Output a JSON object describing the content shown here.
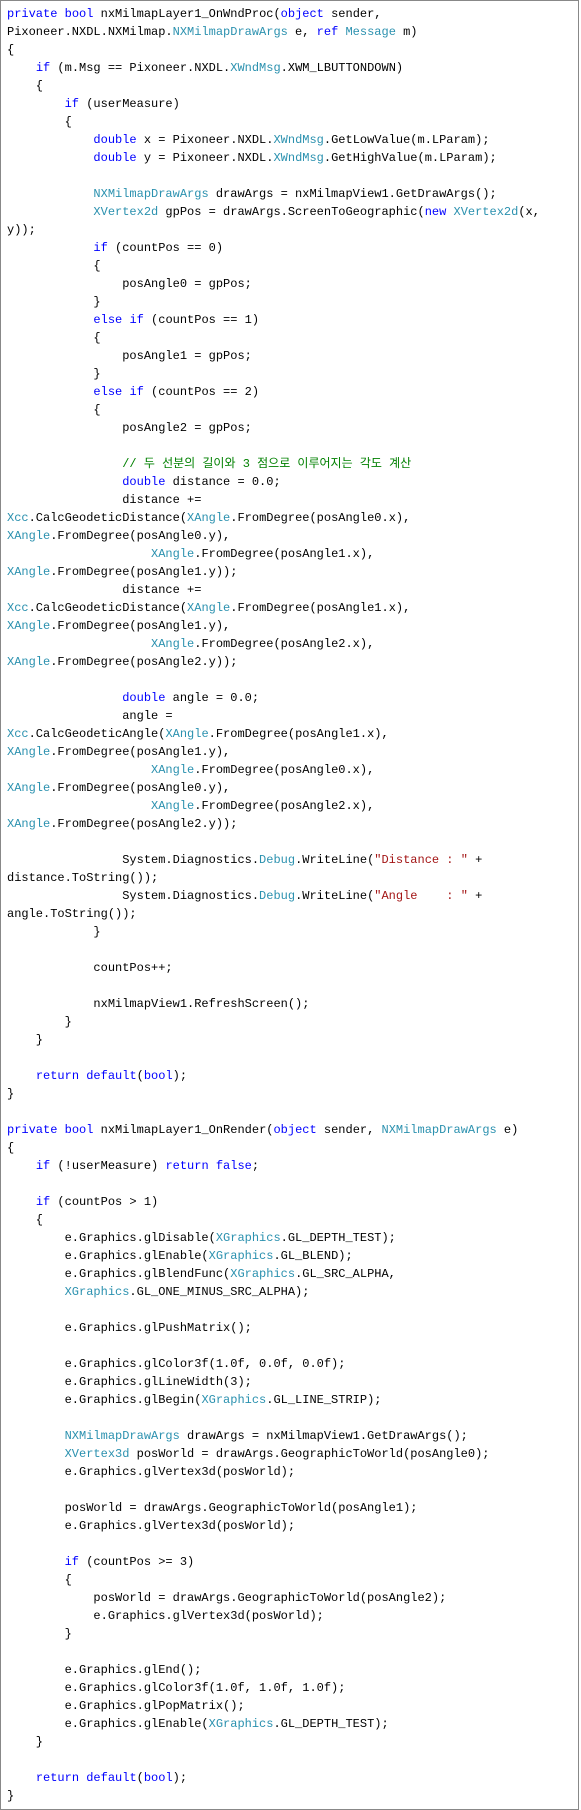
{
  "code": {
    "lines": [
      [
        [
          "k",
          "private"
        ],
        [
          "p",
          " "
        ],
        [
          "k",
          "bool"
        ],
        [
          "p",
          " nxMilmapLayer1_OnWndProc("
        ],
        [
          "k",
          "object"
        ],
        [
          "p",
          " sender, "
        ]
      ],
      [
        [
          "p",
          "Pixoneer.NXDL.NXMilmap."
        ],
        [
          "t",
          "NXMilmapDrawArgs"
        ],
        [
          "p",
          " e, "
        ],
        [
          "k",
          "ref"
        ],
        [
          "p",
          " "
        ],
        [
          "t",
          "Message"
        ],
        [
          "p",
          " m)"
        ]
      ],
      [
        [
          "p",
          "{"
        ]
      ],
      [
        [
          "p",
          "    "
        ],
        [
          "k",
          "if"
        ],
        [
          "p",
          " (m.Msg == Pixoneer.NXDL."
        ],
        [
          "t",
          "XWndMsg"
        ],
        [
          "p",
          ".XWM_LBUTTONDOWN)"
        ]
      ],
      [
        [
          "p",
          "    {"
        ]
      ],
      [
        [
          "p",
          "        "
        ],
        [
          "k",
          "if"
        ],
        [
          "p",
          " (userMeasure)"
        ]
      ],
      [
        [
          "p",
          "        {"
        ]
      ],
      [
        [
          "p",
          "            "
        ],
        [
          "k",
          "double"
        ],
        [
          "p",
          " x = Pixoneer.NXDL."
        ],
        [
          "t",
          "XWndMsg"
        ],
        [
          "p",
          ".GetLowValue(m.LParam);"
        ]
      ],
      [
        [
          "p",
          "            "
        ],
        [
          "k",
          "double"
        ],
        [
          "p",
          " y = Pixoneer.NXDL."
        ],
        [
          "t",
          "XWndMsg"
        ],
        [
          "p",
          ".GetHighValue(m.LParam);"
        ]
      ],
      [
        [
          "p",
          " "
        ]
      ],
      [
        [
          "p",
          "            "
        ],
        [
          "t",
          "NXMilmapDrawArgs"
        ],
        [
          "p",
          " drawArgs = nxMilmapView1.GetDrawArgs();"
        ]
      ],
      [
        [
          "p",
          "            "
        ],
        [
          "t",
          "XVertex2d"
        ],
        [
          "p",
          " gpPos = drawArgs.ScreenToGeographic("
        ],
        [
          "k",
          "new"
        ],
        [
          "p",
          " "
        ],
        [
          "t",
          "XVertex2d"
        ],
        [
          "p",
          "(x, "
        ]
      ],
      [
        [
          "p",
          "y));"
        ]
      ],
      [
        [
          "p",
          "            "
        ],
        [
          "k",
          "if"
        ],
        [
          "p",
          " (countPos == 0)"
        ]
      ],
      [
        [
          "p",
          "            {"
        ]
      ],
      [
        [
          "p",
          "                posAngle0 = gpPos;"
        ]
      ],
      [
        [
          "p",
          "            }"
        ]
      ],
      [
        [
          "p",
          "            "
        ],
        [
          "k",
          "else"
        ],
        [
          "p",
          " "
        ],
        [
          "k",
          "if"
        ],
        [
          "p",
          " (countPos == 1)"
        ]
      ],
      [
        [
          "p",
          "            {"
        ]
      ],
      [
        [
          "p",
          "                posAngle1 = gpPos;"
        ]
      ],
      [
        [
          "p",
          "            }"
        ]
      ],
      [
        [
          "p",
          "            "
        ],
        [
          "k",
          "else"
        ],
        [
          "p",
          " "
        ],
        [
          "k",
          "if"
        ],
        [
          "p",
          " (countPos == 2)"
        ]
      ],
      [
        [
          "p",
          "            {"
        ]
      ],
      [
        [
          "p",
          "                posAngle2 = gpPos;"
        ]
      ],
      [
        [
          "p",
          " "
        ]
      ],
      [
        [
          "p",
          "                "
        ],
        [
          "c",
          "// 두 선분의 길이와 3 점으로 이루어지는 각도 계산"
        ]
      ],
      [
        [
          "p",
          "                "
        ],
        [
          "k",
          "double"
        ],
        [
          "p",
          " distance = 0.0;"
        ]
      ],
      [
        [
          "p",
          "                distance += "
        ]
      ],
      [
        [
          "t",
          "Xcc"
        ],
        [
          "p",
          ".CalcGeodeticDistance("
        ],
        [
          "t",
          "XAngle"
        ],
        [
          "p",
          ".FromDegree(posAngle0.x), "
        ]
      ],
      [
        [
          "t",
          "XAngle"
        ],
        [
          "p",
          ".FromDegree(posAngle0.y),"
        ]
      ],
      [
        [
          "p",
          "                    "
        ],
        [
          "t",
          "XAngle"
        ],
        [
          "p",
          ".FromDegree(posAngle1.x), "
        ]
      ],
      [
        [
          "t",
          "XAngle"
        ],
        [
          "p",
          ".FromDegree(posAngle1.y));"
        ]
      ],
      [
        [
          "p",
          "                distance += "
        ]
      ],
      [
        [
          "t",
          "Xcc"
        ],
        [
          "p",
          ".CalcGeodeticDistance("
        ],
        [
          "t",
          "XAngle"
        ],
        [
          "p",
          ".FromDegree(posAngle1.x), "
        ]
      ],
      [
        [
          "t",
          "XAngle"
        ],
        [
          "p",
          ".FromDegree(posAngle1.y),"
        ]
      ],
      [
        [
          "p",
          "                    "
        ],
        [
          "t",
          "XAngle"
        ],
        [
          "p",
          ".FromDegree(posAngle2.x), "
        ]
      ],
      [
        [
          "t",
          "XAngle"
        ],
        [
          "p",
          ".FromDegree(posAngle2.y));"
        ]
      ],
      [
        [
          "p",
          " "
        ]
      ],
      [
        [
          "p",
          "                "
        ],
        [
          "k",
          "double"
        ],
        [
          "p",
          " angle = 0.0;"
        ]
      ],
      [
        [
          "p",
          "                angle = "
        ]
      ],
      [
        [
          "t",
          "Xcc"
        ],
        [
          "p",
          ".CalcGeodeticAngle("
        ],
        [
          "t",
          "XAngle"
        ],
        [
          "p",
          ".FromDegree(posAngle1.x), "
        ]
      ],
      [
        [
          "t",
          "XAngle"
        ],
        [
          "p",
          ".FromDegree(posAngle1.y),"
        ]
      ],
      [
        [
          "p",
          "                    "
        ],
        [
          "t",
          "XAngle"
        ],
        [
          "p",
          ".FromDegree(posAngle0.x), "
        ]
      ],
      [
        [
          "t",
          "XAngle"
        ],
        [
          "p",
          ".FromDegree(posAngle0.y),"
        ]
      ],
      [
        [
          "p",
          "                    "
        ],
        [
          "t",
          "XAngle"
        ],
        [
          "p",
          ".FromDegree(posAngle2.x), "
        ]
      ],
      [
        [
          "t",
          "XAngle"
        ],
        [
          "p",
          ".FromDegree(posAngle2.y));"
        ]
      ],
      [
        [
          "p",
          " "
        ]
      ],
      [
        [
          "p",
          "                System.Diagnostics."
        ],
        [
          "t",
          "Debug"
        ],
        [
          "p",
          ".WriteLine("
        ],
        [
          "s",
          "\"Distance : \""
        ],
        [
          "p",
          " + "
        ]
      ],
      [
        [
          "p",
          "distance.ToString());"
        ]
      ],
      [
        [
          "p",
          "                System.Diagnostics."
        ],
        [
          "t",
          "Debug"
        ],
        [
          "p",
          ".WriteLine("
        ],
        [
          "s",
          "\"Angle    : \""
        ],
        [
          "p",
          " + "
        ]
      ],
      [
        [
          "p",
          "angle.ToString());"
        ]
      ],
      [
        [
          "p",
          "            }"
        ]
      ],
      [
        [
          "p",
          " "
        ]
      ],
      [
        [
          "p",
          "            countPos++;"
        ]
      ],
      [
        [
          "p",
          " "
        ]
      ],
      [
        [
          "p",
          "            nxMilmapView1.RefreshScreen();"
        ]
      ],
      [
        [
          "p",
          "        }"
        ]
      ],
      [
        [
          "p",
          "    }"
        ]
      ],
      [
        [
          "p",
          " "
        ]
      ],
      [
        [
          "p",
          "    "
        ],
        [
          "k",
          "return"
        ],
        [
          "p",
          " "
        ],
        [
          "k",
          "default"
        ],
        [
          "p",
          "("
        ],
        [
          "k",
          "bool"
        ],
        [
          "p",
          ");"
        ]
      ],
      [
        [
          "p",
          "}"
        ]
      ],
      [
        [
          "p",
          " "
        ]
      ],
      [
        [
          "k",
          "private"
        ],
        [
          "p",
          " "
        ],
        [
          "k",
          "bool"
        ],
        [
          "p",
          " nxMilmapLayer1_OnRender("
        ],
        [
          "k",
          "object"
        ],
        [
          "p",
          " sender, "
        ],
        [
          "t",
          "NXMilmapDrawArgs"
        ],
        [
          "p",
          " e)"
        ]
      ],
      [
        [
          "p",
          "{"
        ]
      ],
      [
        [
          "p",
          "    "
        ],
        [
          "k",
          "if"
        ],
        [
          "p",
          " (!userMeasure) "
        ],
        [
          "k",
          "return"
        ],
        [
          "p",
          " "
        ],
        [
          "k",
          "false"
        ],
        [
          "p",
          ";"
        ]
      ],
      [
        [
          "p",
          " "
        ]
      ],
      [
        [
          "p",
          "    "
        ],
        [
          "k",
          "if"
        ],
        [
          "p",
          " (countPos > 1)"
        ]
      ],
      [
        [
          "p",
          "    {"
        ]
      ],
      [
        [
          "p",
          "        e.Graphics.glDisable("
        ],
        [
          "t",
          "XGraphics"
        ],
        [
          "p",
          ".GL_DEPTH_TEST);"
        ]
      ],
      [
        [
          "p",
          "        e.Graphics.glEnable("
        ],
        [
          "t",
          "XGraphics"
        ],
        [
          "p",
          ".GL_BLEND);"
        ]
      ],
      [
        [
          "p",
          "        e.Graphics.glBlendFunc("
        ],
        [
          "t",
          "XGraphics"
        ],
        [
          "p",
          ".GL_SRC_ALPHA, "
        ]
      ],
      [
        [
          "p",
          "        "
        ],
        [
          "t",
          "XGraphics"
        ],
        [
          "p",
          ".GL_ONE_MINUS_SRC_ALPHA);"
        ]
      ],
      [
        [
          "p",
          " "
        ]
      ],
      [
        [
          "p",
          "        e.Graphics.glPushMatrix();"
        ]
      ],
      [
        [
          "p",
          " "
        ]
      ],
      [
        [
          "p",
          "        e.Graphics.glColor3f(1.0f, 0.0f, 0.0f);"
        ]
      ],
      [
        [
          "p",
          "        e.Graphics.glLineWidth(3);"
        ]
      ],
      [
        [
          "p",
          "        e.Graphics.glBegin("
        ],
        [
          "t",
          "XGraphics"
        ],
        [
          "p",
          ".GL_LINE_STRIP);"
        ]
      ],
      [
        [
          "p",
          " "
        ]
      ],
      [
        [
          "p",
          "        "
        ],
        [
          "t",
          "NXMilmapDrawArgs"
        ],
        [
          "p",
          " drawArgs = nxMilmapView1.GetDrawArgs();"
        ]
      ],
      [
        [
          "p",
          "        "
        ],
        [
          "t",
          "XVertex3d"
        ],
        [
          "p",
          " posWorld = drawArgs.GeographicToWorld(posAngle0);"
        ]
      ],
      [
        [
          "p",
          "        e.Graphics.glVertex3d(posWorld);"
        ]
      ],
      [
        [
          "p",
          " "
        ]
      ],
      [
        [
          "p",
          "        posWorld = drawArgs.GeographicToWorld(posAngle1);"
        ]
      ],
      [
        [
          "p",
          "        e.Graphics.glVertex3d(posWorld);"
        ]
      ],
      [
        [
          "p",
          " "
        ]
      ],
      [
        [
          "p",
          "        "
        ],
        [
          "k",
          "if"
        ],
        [
          "p",
          " (countPos >= 3)"
        ]
      ],
      [
        [
          "p",
          "        {"
        ]
      ],
      [
        [
          "p",
          "            posWorld = drawArgs.GeographicToWorld(posAngle2);"
        ]
      ],
      [
        [
          "p",
          "            e.Graphics.glVertex3d(posWorld);"
        ]
      ],
      [
        [
          "p",
          "        }"
        ]
      ],
      [
        [
          "p",
          " "
        ]
      ],
      [
        [
          "p",
          "        e.Graphics.glEnd();"
        ]
      ],
      [
        [
          "p",
          "        e.Graphics.glColor3f(1.0f, 1.0f, 1.0f);"
        ]
      ],
      [
        [
          "p",
          "        e.Graphics.glPopMatrix();"
        ]
      ],
      [
        [
          "p",
          "        e.Graphics.glEnable("
        ],
        [
          "t",
          "XGraphics"
        ],
        [
          "p",
          ".GL_DEPTH_TEST);"
        ]
      ],
      [
        [
          "p",
          "    }"
        ]
      ],
      [
        [
          "p",
          " "
        ]
      ],
      [
        [
          "p",
          "    "
        ],
        [
          "k",
          "return"
        ],
        [
          "p",
          " "
        ],
        [
          "k",
          "default"
        ],
        [
          "p",
          "("
        ],
        [
          "k",
          "bool"
        ],
        [
          "p",
          ");"
        ]
      ],
      [
        [
          "p",
          "}"
        ]
      ]
    ]
  }
}
